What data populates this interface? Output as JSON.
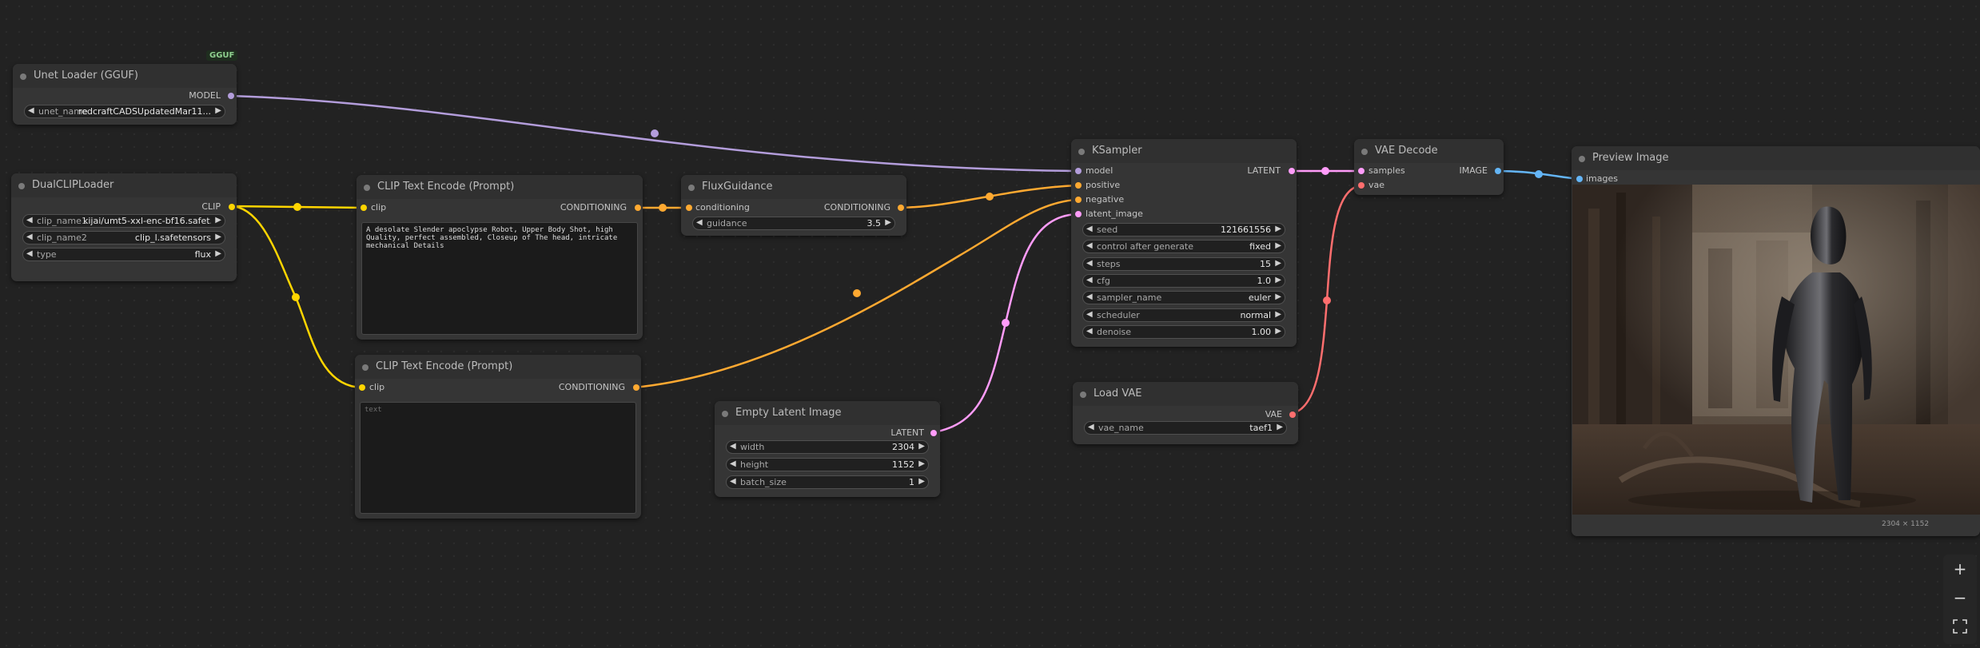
{
  "colors": {
    "canvas": "#222222",
    "model": "#b39ddb",
    "clip": "#ffd500",
    "conditioning": "#ffa931",
    "latent": "#ff9cf9",
    "vae": "#ff6e6e",
    "image": "#64b5f6"
  },
  "badge": "GGUF",
  "nodes": {
    "unet": {
      "title": "Unet Loader (GGUF)",
      "outputs": [
        "MODEL"
      ],
      "widgets": [
        {
          "label": "unet_name",
          "value": "redcraftCADSUpdatedMar11..."
        }
      ]
    },
    "dualclip": {
      "title": "DualCLIPLoader",
      "outputs": [
        "CLIP"
      ],
      "widgets": [
        {
          "label": "clip_name1",
          "value": "kijai/umt5-xxl-enc-bf16.safet..."
        },
        {
          "label": "clip_name2",
          "value": "clip_l.safetensors"
        },
        {
          "label": "type",
          "value": "flux"
        }
      ]
    },
    "clip_pos": {
      "title": "CLIP Text Encode (Prompt)",
      "inputs": [
        "clip"
      ],
      "outputs": [
        "CONDITIONING"
      ],
      "text": "A desolate Slender apoclypse Robot, Upper Body Shot, high Quality, perfect assembled, Closeup of The head, intricate mechanical Details"
    },
    "clip_neg": {
      "title": "CLIP Text Encode (Prompt)",
      "inputs": [
        "clip"
      ],
      "outputs": [
        "CONDITIONING"
      ],
      "placeholder": "text"
    },
    "flux": {
      "title": "FluxGuidance",
      "inputs": [
        "conditioning"
      ],
      "outputs": [
        "CONDITIONING"
      ],
      "widgets": [
        {
          "label": "guidance",
          "value": "3.5"
        }
      ]
    },
    "latent": {
      "title": "Empty Latent Image",
      "outputs": [
        "LATENT"
      ],
      "widgets": [
        {
          "label": "width",
          "value": "2304"
        },
        {
          "label": "height",
          "value": "1152"
        },
        {
          "label": "batch_size",
          "value": "1"
        }
      ]
    },
    "ksampler": {
      "title": "KSampler",
      "inputs": [
        "model",
        "positive",
        "negative",
        "latent_image"
      ],
      "outputs": [
        "LATENT"
      ],
      "widgets": [
        {
          "label": "seed",
          "value": "121661556"
        },
        {
          "label": "control after generate",
          "value": "fixed"
        },
        {
          "label": "steps",
          "value": "15"
        },
        {
          "label": "cfg",
          "value": "1.0"
        },
        {
          "label": "sampler_name",
          "value": "euler"
        },
        {
          "label": "scheduler",
          "value": "normal"
        },
        {
          "label": "denoise",
          "value": "1.00"
        }
      ]
    },
    "loadvae": {
      "title": "Load VAE",
      "outputs": [
        "VAE"
      ],
      "widgets": [
        {
          "label": "vae_name",
          "value": "taef1"
        }
      ]
    },
    "vaedecode": {
      "title": "VAE Decode",
      "inputs": [
        "samples",
        "vae"
      ],
      "outputs": [
        "IMAGE"
      ]
    },
    "preview": {
      "title": "Preview Image",
      "inputs": [
        "images"
      ],
      "caption": "2304 × 1152"
    }
  },
  "zoom": {
    "in_icon": "plus-icon",
    "out_icon": "minus-icon",
    "fit_icon": "fit-view-icon"
  }
}
